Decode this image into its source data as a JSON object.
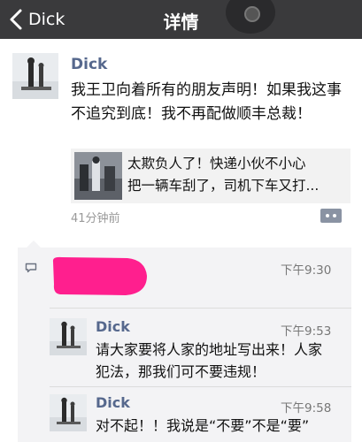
{
  "nav": {
    "back_label": "Dick",
    "title": "详情"
  },
  "post": {
    "author": "Dick",
    "text": "我王卫向着所有的朋友声明！如果我这事不追究到底！我不再配做顺丰总裁！",
    "shared_link": {
      "line1": "太欺负人了！快递小伙不小心",
      "line2": "把一辆车刮了，司机下车又打..."
    },
    "time": "41分钟前"
  },
  "likes_row": {
    "time": "下午9:30"
  },
  "comments": [
    {
      "author": "Dick",
      "time": "下午9:53",
      "text": "请大家要将人家的地址写出来！人家犯法，那我们可不要违规！"
    },
    {
      "author": "Dick",
      "time": "下午9:58",
      "text": "对不起！！我说是“不要”不是“要”"
    }
  ],
  "colors": {
    "nav_bg": "#3a3a3c",
    "name_blue": "#56688d",
    "redaction_pink": "#ff1f8e",
    "comment_bg": "#f3f3f5"
  }
}
